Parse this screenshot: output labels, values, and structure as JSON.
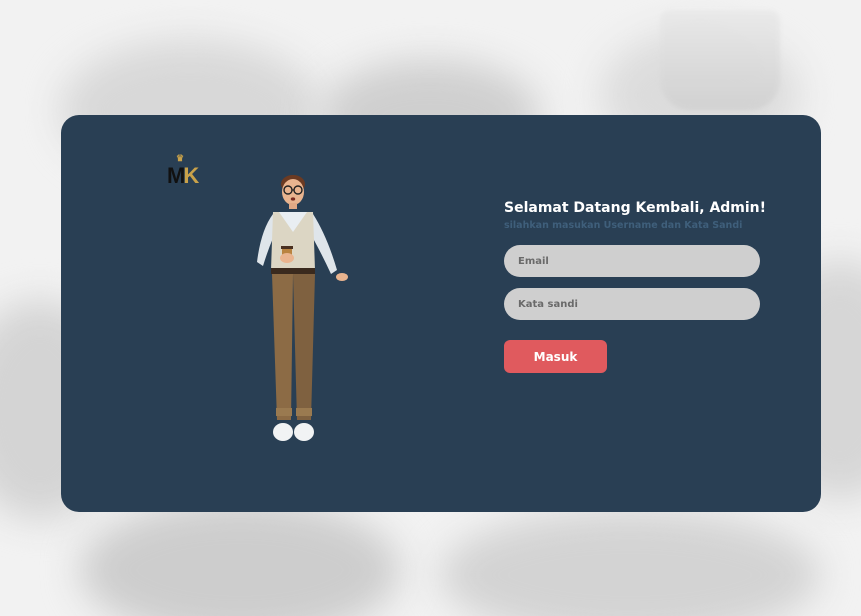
{
  "brand": {
    "logo_left": "M",
    "logo_right": "K",
    "crown_glyph": "♛"
  },
  "login": {
    "title": "Selamat Datang Kembali, Admin!",
    "subtitle": "silahkan masukan Username dan Kata Sandi",
    "email_placeholder": "Email",
    "email_value": "",
    "password_placeholder": "Kata sandi",
    "password_value": "",
    "submit_label": "Masuk"
  },
  "colors": {
    "card_background": "#293f54",
    "submit_button": "#e05a5e",
    "input_background": "#cfcfcf",
    "logo_accent": "#c9a24a"
  },
  "icons": {
    "crown": "crown-icon",
    "illustration": "man-holding-coffee-illustration"
  }
}
